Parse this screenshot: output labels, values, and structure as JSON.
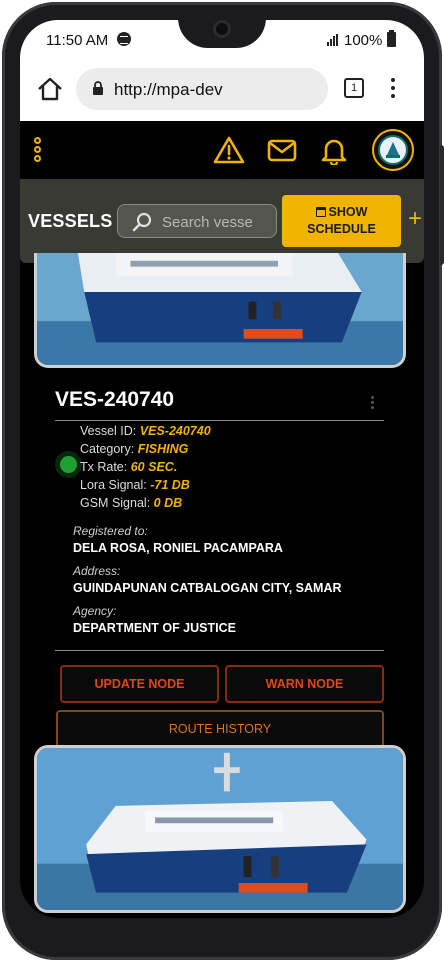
{
  "status_bar": {
    "time": "11:50 AM",
    "battery": "100%"
  },
  "browser": {
    "url": "http://mpa-dev",
    "tab_count": "1"
  },
  "toolbar": {
    "title": "VESSELS",
    "search_placeholder": "Search vesse",
    "show_schedule_line1": "SHOW",
    "show_schedule_line2": "SCHEDULE",
    "add_label": "+"
  },
  "vessel": {
    "name": "VES-240740",
    "fields": [
      {
        "label": "Vessel ID:",
        "value": "VES-240740"
      },
      {
        "label": "Category:",
        "value": "FISHING"
      },
      {
        "label": "Tx Rate:",
        "value": "60 SEC."
      },
      {
        "label": "Lora Signal:",
        "value": "-71 DB"
      },
      {
        "label": "GSM Signal:",
        "value": "0 DB"
      }
    ],
    "registered_label": "Registered to:",
    "registered_value": "DELA ROSA, RONIEL PACAMPARA",
    "address_label": "Address:",
    "address_value": "GUINDAPUNAN CATBALOGAN CITY, SAMAR",
    "agency_label": "Agency:",
    "agency_value": "DEPARTMENT OF JUSTICE",
    "status_color": "#1ea035"
  },
  "actions": {
    "update_node": "UPDATE NODE",
    "warn_node": "WARN NODE",
    "route_history": "ROUTE HISTORY"
  },
  "colors": {
    "accent": "#f0b400",
    "danger": "#e0451c",
    "background": "#000000"
  },
  "icons": [
    "home-icon",
    "lock-icon",
    "tabs-icon",
    "more-vert-icon",
    "menu-icon",
    "warning-icon",
    "mail-icon",
    "bell-icon",
    "avatar-logo",
    "search-icon",
    "calendar-icon",
    "plus-icon"
  ]
}
